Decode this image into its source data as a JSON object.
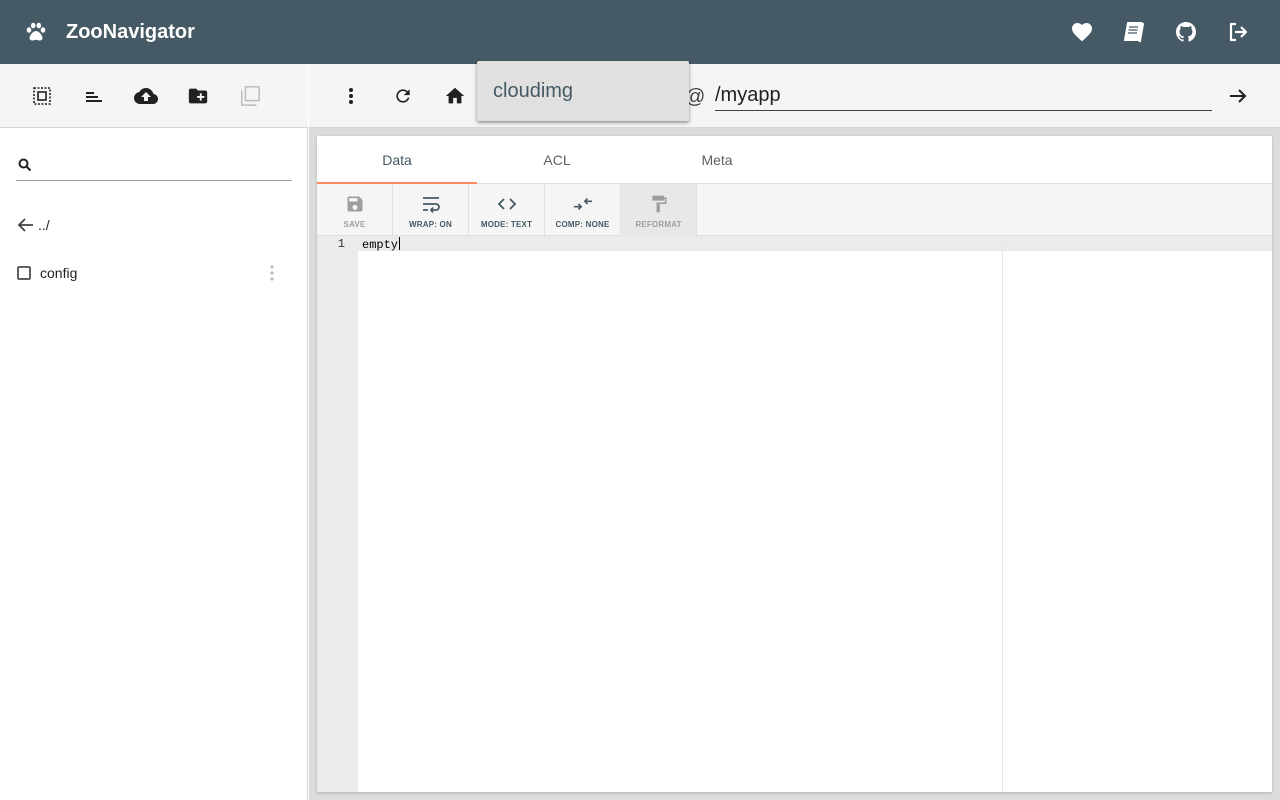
{
  "header": {
    "title": "ZooNavigator",
    "icons": [
      "paw-icon",
      "heart-icon",
      "book-icon",
      "github-icon",
      "logout-icon"
    ],
    "bg_color": "#455a64"
  },
  "left_toolbar": {
    "icons": [
      "select-all-icon",
      "sort-icon",
      "upload-icon",
      "new-folder-icon",
      "duplicate-icon"
    ]
  },
  "search": {
    "placeholder": "",
    "value": ""
  },
  "tree": {
    "parent_label": "../",
    "nodes": [
      {
        "label": "config",
        "checked": false
      }
    ]
  },
  "path_bar": {
    "connection_options": [
      "cloudimg"
    ],
    "at_symbol": "@",
    "path": "/myapp"
  },
  "tabs": {
    "items": [
      "Data",
      "ACL",
      "Meta"
    ],
    "active": "Data",
    "accent_color": "#ff8a65"
  },
  "editor_toolbar": {
    "save_label": "SAVE",
    "wrap_label": "WRAP: ON",
    "mode_label": "MODE: TEXT",
    "comp_label": "COMP: NONE",
    "reformat_label": "REFORMAT"
  },
  "editor": {
    "line_number": "1",
    "content": "empty"
  }
}
